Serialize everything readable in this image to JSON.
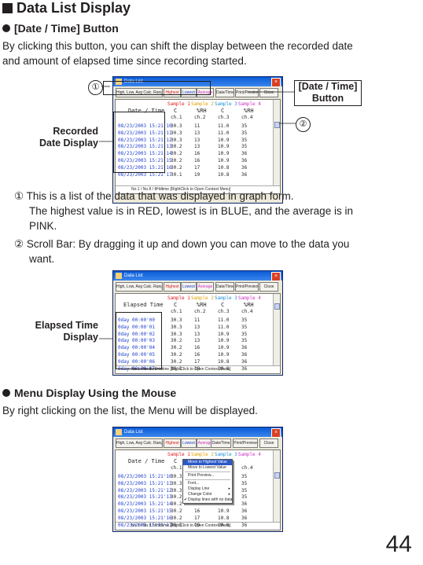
{
  "heading": "Data List Display",
  "section1": {
    "title": "[Date / Time] Button",
    "intro_line1": "By clicking this button, you can shift the display between the recorded date",
    "intro_line2": "and amount of elapsed time since recording started."
  },
  "callouts": {
    "marker1": "①",
    "marker2": "②",
    "date_time_button_line1": "[Date / Time]",
    "date_time_button_line2": "Button",
    "recorded_line1": "Recorded",
    "recorded_line2": "Date Display",
    "elapsed_line1": "Elapsed Time",
    "elapsed_line2": "Display"
  },
  "notes": {
    "n1_marker": "①",
    "n1_line1": "This is a list of the data that was displayed in graph form.",
    "n1_line2": "The highest value is in RED, lowest is in BLUE, and the average is in",
    "n1_line3": "PINK.",
    "n2_marker": "②",
    "n2_line1": "Scroll Bar: By dragging it up and down you can move to the data you",
    "n2_line2": "want."
  },
  "section2": {
    "title": "Menu Display Using the Mouse",
    "intro": "By right clicking on the list, the Menu will be displayed."
  },
  "window": {
    "title": "Data List",
    "close_glyph": "×",
    "buttons": {
      "hla": "High, Low, Avg Calc. Range",
      "highest": "Highest",
      "lowest": "Lowest",
      "average": "Average",
      "datetime": "Date/Time",
      "print": "Print/Preview",
      "close": "Close"
    },
    "col_datetime": "Date / Time",
    "col_elapsed": "Elapsed Time",
    "samples": [
      "Sample 1",
      "Sample 2",
      "Sample 3",
      "Sample 4"
    ],
    "units": [
      "C",
      "%RH",
      "C",
      "%RH"
    ],
    "channels": [
      "ch.1",
      "ch.2",
      "ch.3",
      "ch.4"
    ],
    "dates": [
      "08/23/2003 15:21'10",
      "08/23/2003 15:21'11",
      "08/23/2003 15:21'12",
      "08/23/2003 15:21'13",
      "08/23/2003 15:21'14",
      "08/23/2003 15:21'15",
      "08/23/2003 15:21'16",
      "08/23/2003 15:21'17"
    ],
    "elapsed": [
      "0day 00:00'00",
      "0day 00:00'01",
      "0day 00:00'02",
      "0day 00:00'03",
      "0day 00:00'04",
      "0day 00:00'05",
      "0day 00:00'06",
      "0day 00:00'07"
    ],
    "ch1": [
      "30.3",
      "30.3",
      "30.3",
      "30.2",
      "30.2",
      "30.2",
      "30.2",
      "30.1"
    ],
    "ch2": [
      "11",
      "13",
      "13",
      "13",
      "16",
      "16",
      "17",
      "19"
    ],
    "ch3": [
      "11.0",
      "11.0",
      "10.9",
      "10.9",
      "10.9",
      "10.9",
      "10.8",
      "10.8"
    ],
    "ch4": [
      "35",
      "35",
      "35",
      "35",
      "36",
      "36",
      "36",
      "36"
    ],
    "status": "No.1 / No.8 / 8Hdtime  [RightClick to Open Context Menu]"
  },
  "context_menu": {
    "items": [
      "Move to Highest Value",
      "Move to Lowest Value",
      "Print Preview...",
      "Font...",
      "Display Line",
      "Change Color",
      "Display lines with no data"
    ],
    "check_glyph": "✔",
    "submenu_glyph": "▸"
  },
  "colors": {
    "highest": "#e02020",
    "lowest": "#2040d0",
    "average": "#d030c0",
    "sample2": "#e0a000",
    "sample3": "#2090d0",
    "sample4": "#d030c0"
  },
  "page_number": "44"
}
